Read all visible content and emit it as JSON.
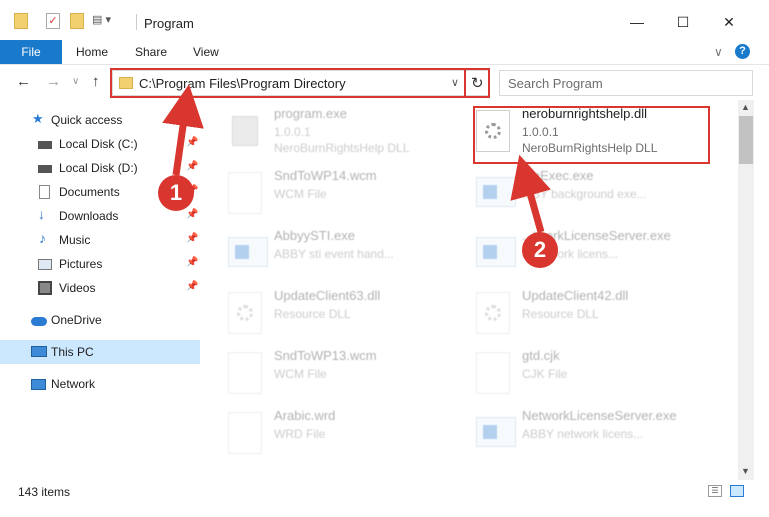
{
  "window": {
    "title": "Program",
    "minimize": "—",
    "maximize": "☐",
    "close": "✕"
  },
  "ribbon": {
    "file": "File",
    "tabs": [
      "Home",
      "Share",
      "View"
    ],
    "help": "?",
    "collapse": "∨"
  },
  "nav": {
    "back": "←",
    "forward": "→",
    "dropdown": "∨",
    "up": "↑"
  },
  "address": {
    "path": "C:\\Program Files\\Program Directory",
    "dropdown": "∨",
    "refresh": "↻"
  },
  "search": {
    "placeholder": "Search Program"
  },
  "sidebar": {
    "quick_access": "Quick access",
    "items": [
      "Local Disk (C:)",
      "Local Disk (D:)",
      "Documents",
      "Downloads",
      "Music",
      "Pictures",
      "Videos"
    ],
    "onedrive": "OneDrive",
    "thispc": "This PC",
    "network": "Network"
  },
  "files": [
    {
      "name": "program.exe",
      "l1": "1.0.0.1",
      "l2": "NeroBurnRightsHelp DLL",
      "type": "exe",
      "dim": true
    },
    {
      "name": "neroburnrightshelp.dll",
      "l1": "1.0.0.1",
      "l2": "NeroBurnRightsHelp DLL",
      "type": "dll",
      "dim": false
    },
    {
      "name": "SndToWP14.wcm",
      "l1": "WCM File",
      "l2": "",
      "type": "doc",
      "dim": true
    },
    {
      "name": "...eExec.exe",
      "l1": "...BY background exe...",
      "l2": "",
      "type": "exe",
      "dim": true
    },
    {
      "name": "AbbyySTI.exe",
      "l1": "ABBY sti event hand...",
      "l2": "",
      "type": "exe",
      "dim": true
    },
    {
      "name": "...tworkLicenseServer.exe",
      "l1": "...network licens...",
      "l2": "",
      "type": "exe",
      "dim": true
    },
    {
      "name": "UpdateClient63.dll",
      "l1": "Resource DLL",
      "l2": "",
      "type": "dll",
      "dim": true
    },
    {
      "name": "UpdateClient42.dll",
      "l1": "Resource DLL",
      "l2": "",
      "type": "dll",
      "dim": true
    },
    {
      "name": "SndToWP13.wcm",
      "l1": "WCM File",
      "l2": "",
      "type": "doc",
      "dim": true
    },
    {
      "name": "gtd.cjk",
      "l1": "CJK File",
      "l2": "",
      "type": "doc",
      "dim": true
    },
    {
      "name": "Arabic.wrd",
      "l1": "WRD File",
      "l2": "",
      "type": "doc",
      "dim": true
    },
    {
      "name": "NetworkLicenseServer.exe",
      "l1": "ABBY network licens...",
      "l2": "",
      "type": "exe",
      "dim": true
    }
  ],
  "status": {
    "count": "143 items"
  },
  "callouts": {
    "one": "1",
    "two": "2"
  },
  "colors": {
    "accent": "#1979ca",
    "highlight": "#d9362f",
    "selected": "#cce8ff"
  }
}
